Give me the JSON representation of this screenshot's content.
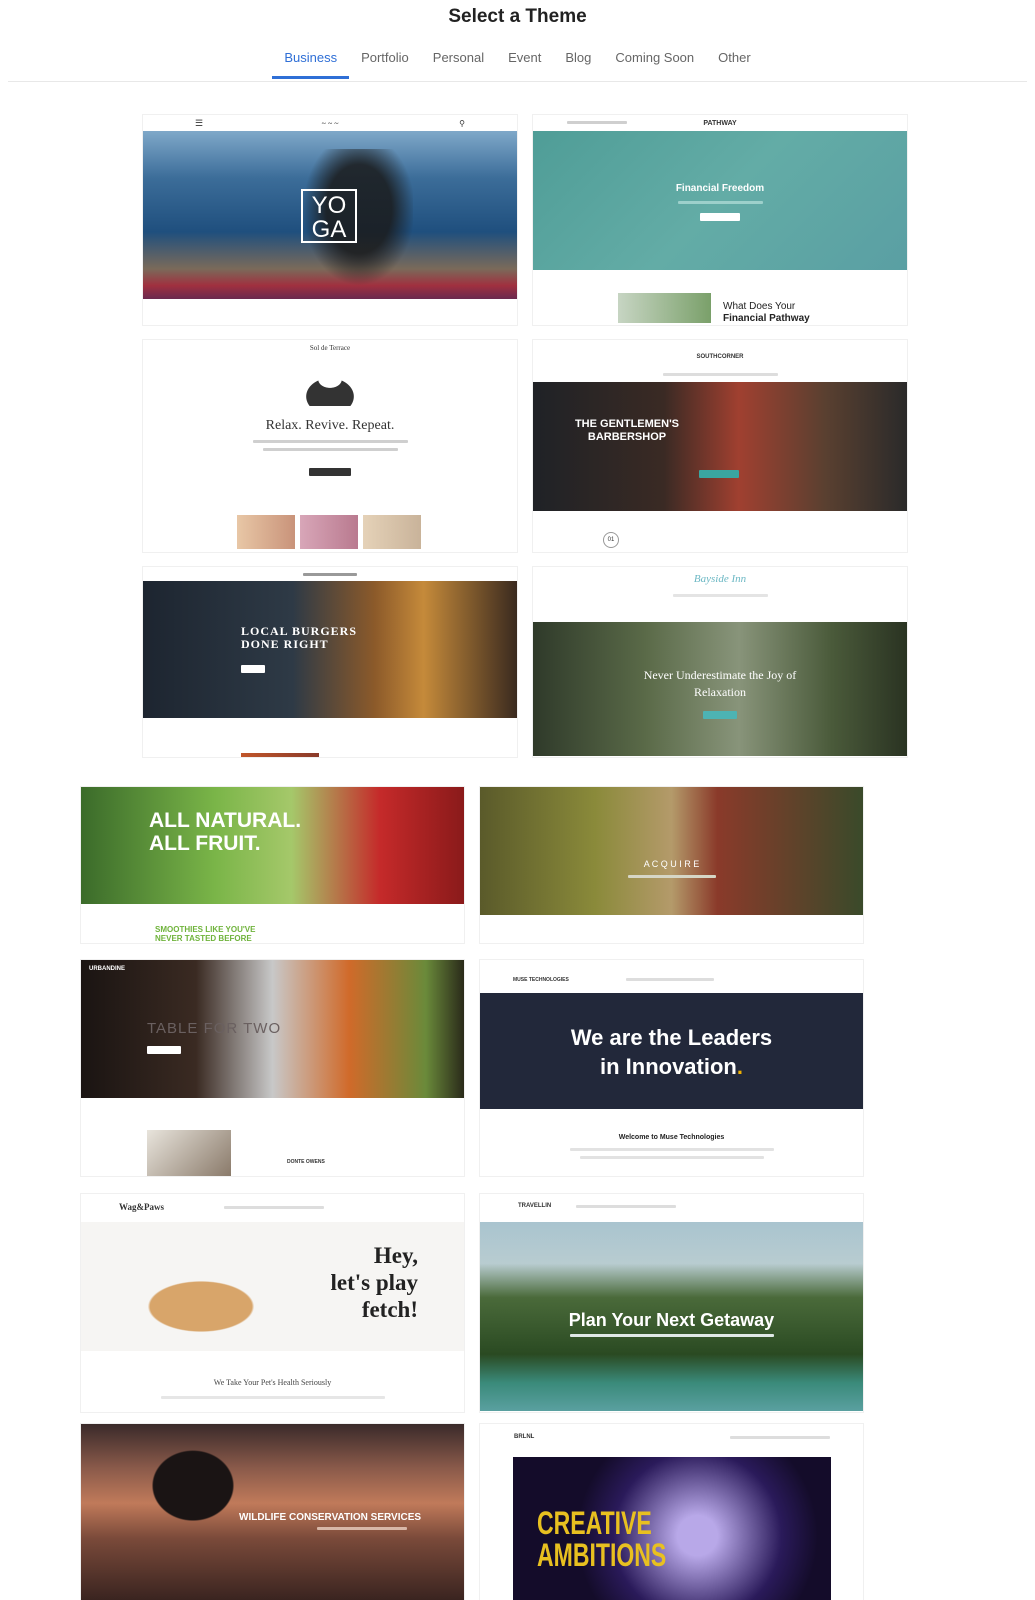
{
  "header": {
    "title": "Select a Theme",
    "tabs": [
      {
        "label": "Business",
        "active": true
      },
      {
        "label": "Portfolio",
        "active": false
      },
      {
        "label": "Personal",
        "active": false
      },
      {
        "label": "Event",
        "active": false
      },
      {
        "label": "Blog",
        "active": false
      },
      {
        "label": "Coming Soon",
        "active": false
      },
      {
        "label": "Other",
        "active": false
      }
    ]
  },
  "themes": {
    "yoga": {
      "hero_line1": "YO",
      "hero_line2": "GA"
    },
    "pathway": {
      "brand": "PATHWAY",
      "hero_title": "Financial Freedom",
      "section_title_1": "What Does Your",
      "section_title_2": "Financial Pathway"
    },
    "terrace": {
      "brand": "Sol de Terrace",
      "headline": "Relax. Revive. Repeat."
    },
    "barber": {
      "brand": "SOUTHCORNER",
      "headline_1": "THE GENTLEMEN'S",
      "headline_2": "BARBERSHOP",
      "badge": "01"
    },
    "burgers": {
      "headline_1": "LOCAL BURGERS",
      "headline_2": "DONE RIGHT"
    },
    "bayside": {
      "brand": "Bayside Inn",
      "headline_1": "Never Underestimate the Joy of",
      "headline_2": "Relaxation"
    },
    "smoothie": {
      "headline_1": "ALL NATURAL.",
      "headline_2": "ALL FRUIT.",
      "tagline_1": "SMOOTHIES LIKE YOU'VE",
      "tagline_2": "NEVER TASTED BEFORE"
    },
    "acquire": {
      "headline": "A C Q U I R E"
    },
    "urbandine": {
      "brand": "URBANDINE",
      "hero_text": "TABLE FOR TWO",
      "chef": "DONTE OWENS"
    },
    "muse": {
      "brand": "MUSE TECHNOLOGIES",
      "headline_1": "We are the Leaders",
      "headline_2": "in Innovation",
      "headline_dot": ".",
      "welcome": "Welcome to Muse Technologies"
    },
    "wagpaws": {
      "brand": "Wag&Paws",
      "headline_1": "Hey,",
      "headline_2": "let's play",
      "headline_3": "fetch!",
      "tagline": "We Take Your Pet's Health Seriously"
    },
    "travellin": {
      "brand": "TRAVELLIN",
      "headline": "Plan Your Next Getaway"
    },
    "wildlife": {
      "headline": "WILDLIFE CONSERVATION SERVICES"
    },
    "creative": {
      "brand": "BRLNL",
      "headline_1": "CREATIVE",
      "headline_2": "AMBITIONS"
    }
  },
  "colors": {
    "accent": "#2f6fd6",
    "pathway_teal": "#5aa7a0",
    "muse_navy": "#22283a",
    "muse_dot": "#f0b000",
    "smoothie_green": "#6fb33b"
  }
}
